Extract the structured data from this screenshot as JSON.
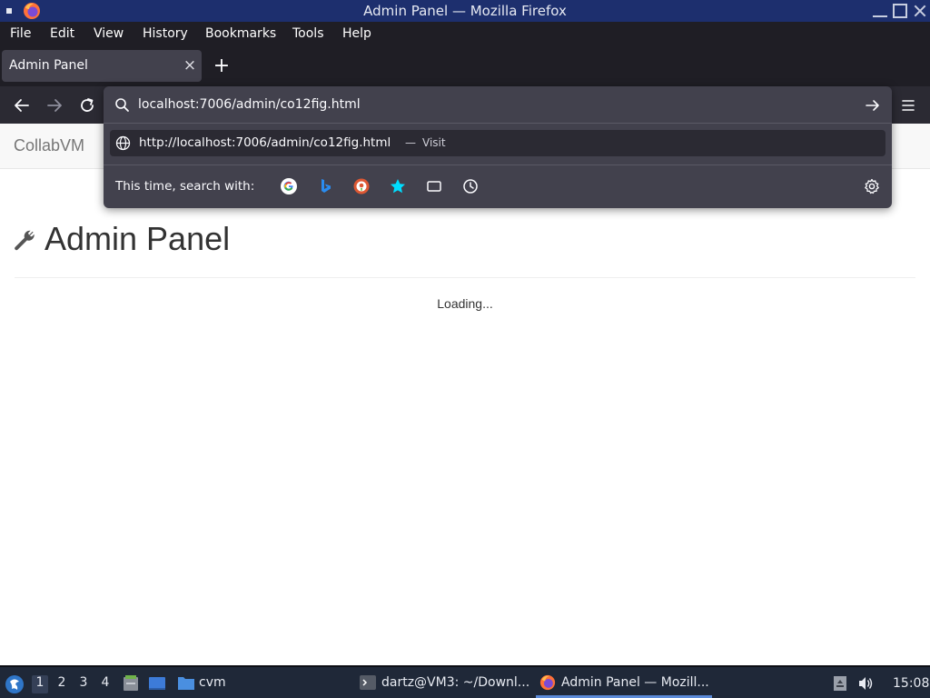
{
  "window": {
    "title": "Admin Panel — Mozilla Firefox"
  },
  "menubar": {
    "items": [
      "File",
      "Edit",
      "View",
      "History",
      "Bookmarks",
      "Tools",
      "Help"
    ]
  },
  "tabs": [
    {
      "title": "Admin Panel",
      "close": "×"
    }
  ],
  "newtab": "+",
  "urlbar": {
    "value": "localhost:7006/admin/co12fig.html",
    "result": {
      "url": "http://localhost:7006/admin/co12fig.html",
      "dash": "—",
      "action": "Visit"
    },
    "one_off_label": "This time, search with:",
    "engines": [
      "google-icon",
      "bing-icon",
      "duckduckgo-icon",
      "bookmarks-search-icon",
      "tabs-search-icon",
      "history-search-icon"
    ]
  },
  "page": {
    "brand": "CollabVM",
    "heading": "Admin Panel",
    "loading": "Loading..."
  },
  "taskbar": {
    "workspaces": [
      "1",
      "2",
      "3",
      "4"
    ],
    "active_workspace": "1",
    "folder_label": "cvm",
    "tasks": [
      {
        "label": "dartz@VM3: ~/Downl...",
        "icon": "terminal-icon"
      },
      {
        "label": "Admin Panel — Mozill...",
        "icon": "firefox-icon"
      }
    ],
    "clock": "15:08"
  },
  "colors": {
    "titlebar": "#1d2f6e",
    "chrome_dark": "#1f1e25",
    "toolbar": "#2b2a33",
    "panel": "#42414d",
    "taskbar": "#1f2838"
  }
}
